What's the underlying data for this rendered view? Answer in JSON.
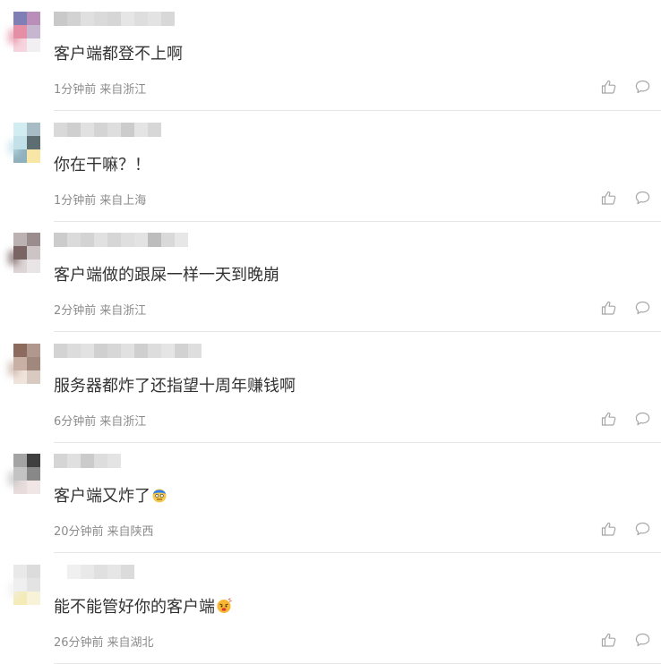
{
  "comments": [
    {
      "text": "客户端都登不上啊",
      "time": "1分钟前",
      "location": "来自浙江",
      "avatar_colors": [
        "#7f7fb5",
        "#b98fb9",
        "#e48fa6",
        "#c6b6cf",
        "#f6d5de",
        "#f2eff3"
      ],
      "name_colors": [
        "#c9c9c9",
        "#d2d2d2",
        "#e0e0e0",
        "#dadada",
        "#d6d6d6",
        "#e6e6e6",
        "#dedede",
        "#e3e3e3",
        "#d8d8d8"
      ]
    },
    {
      "text": "你在干嘛？！",
      "time": "1分钟前",
      "location": "来自上海",
      "avatar_colors": [
        "#d2edf1",
        "#a8bcc6",
        "#c2e1e8",
        "#5d6d72",
        "#8fb0bd",
        "#f7e6a6"
      ],
      "name_colors": [
        "#d9d9d9",
        "#cfcfcf",
        "#e1e1e1",
        "#d4d4d4",
        "#dedede",
        "#cccccc",
        "#e4e4e4",
        "#d7d7d7"
      ]
    },
    {
      "text": "客户端做的跟屎一样一天到晚崩",
      "time": "2分钟前",
      "location": "来自浙江",
      "avatar_colors": [
        "#bdb2b3",
        "#9b8c8e",
        "#7a6464",
        "#ccc4c5",
        "#ddd5d6",
        "#e9e5e6"
      ],
      "name_colors": [
        "#cccccc",
        "#dbdbdb",
        "#d3d3d3",
        "#e1e1e1",
        "#d6d6d6",
        "#dfdfdf",
        "#e3e3e3",
        "#bdbdbd",
        "#d9d9d9",
        "#e7e7e7"
      ]
    },
    {
      "text": "服务器都炸了还指望十周年赚钱啊",
      "time": "6分钟前",
      "location": "来自浙江",
      "avatar_colors": [
        "#8c6b5e",
        "#b1988f",
        "#c8b0a4",
        "#a0887d",
        "#efe4dc",
        "#d8c9c1"
      ],
      "name_colors": [
        "#d3d3d3",
        "#dcdcdc",
        "#e2e2e2",
        "#d0d0d0",
        "#d7d7d7",
        "#e1e1e1",
        "#cfcfcf",
        "#dddddd",
        "#e5e5e5",
        "#d2d2d2",
        "#dedede"
      ]
    },
    {
      "text": "客户端又炸了",
      "time": "20分钟前",
      "location": "来自陕西",
      "avatar_colors": [
        "#a4a4a4",
        "#3f3f3f",
        "#c3c3c3",
        "#888888",
        "#e8dcdc",
        "#f0e6e6"
      ],
      "name_colors": [
        "#d5d5d5",
        "#e0e0e0",
        "#cbcbcb",
        "#dddddd",
        "#e4e4e4"
      ],
      "emoji": "exploded-face"
    },
    {
      "text": "能不能管好你的客户端",
      "time": "26分钟前",
      "location": "来自湖北",
      "avatar_colors": [
        "#e9e9e9",
        "#dcdcdc",
        "#efefef",
        "#e3e3e3",
        "#f5ebb7",
        "#f8f3d8"
      ],
      "name_colors": [
        "#f0f0f0",
        "#e9e9e9",
        "#e0e0e0",
        "#e6e6e6",
        "#dbdbdb"
      ],
      "emoji": "angry-face"
    }
  ],
  "icons": {
    "like": "thumb-up-icon",
    "reply": "comment-bubble-icon"
  },
  "colors": {
    "text": "#333333",
    "meta": "#8c8c8c",
    "icon": "#a6a6a6",
    "divider": "#e6e6e6"
  }
}
